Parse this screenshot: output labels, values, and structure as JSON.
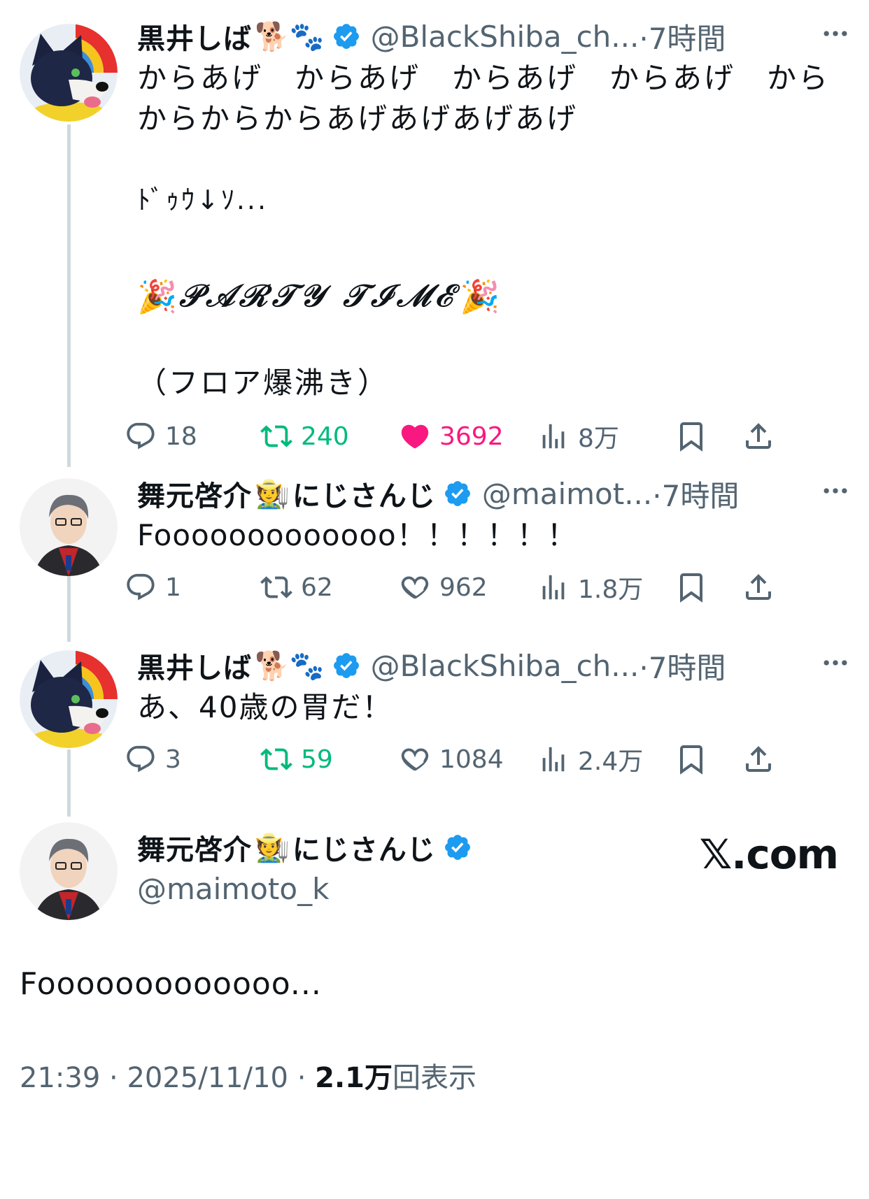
{
  "tweets": [
    {
      "name": "黒井しば",
      "name_emoji": "🐕🐾",
      "handle": "@BlackShiba_ch...",
      "time": "·7時間",
      "text_lines": [
        "からあげ　からあげ　からあげ　からあげ　から",
        "からからからあげあげあげあげ",
        "",
        "ﾄﾞｩｳ↓ｿ...",
        "",
        "PARTY TIME",
        "",
        "（フロア爆沸き）"
      ],
      "party_line": "𝒫𝒜ℛ𝒯𝒴 𝒯ℐℳℰ",
      "party_emoji": "🎉",
      "replies": "18",
      "retweets": "240",
      "likes": "3692",
      "views": "8万",
      "retweeted": true,
      "liked": true
    },
    {
      "name": "舞元啓介",
      "name_emoji": "🧑‍🌾",
      "name_suffix": "にじさんじ",
      "handle": "@maimot...",
      "time": "·7時間",
      "text": "Fooooooooooooo！！！！！！",
      "replies": "1",
      "retweets": "62",
      "likes": "962",
      "views": "1.8万",
      "retweeted": false,
      "liked": false
    },
    {
      "name": "黒井しば",
      "name_emoji": "🐕🐾",
      "handle": "@BlackShiba_ch...",
      "time": "·7時間",
      "text": "あ、40歳の胃だ！",
      "replies": "3",
      "retweets": "59",
      "likes": "1084",
      "views": "2.4万",
      "retweeted": true,
      "liked": false
    }
  ],
  "main": {
    "name": "舞元啓介",
    "name_emoji": "🧑‍🌾",
    "name_suffix": "にじさんじ",
    "handle": "@maimoto_k",
    "brand": "𝕏.com",
    "text": "Fooooooooooooo...",
    "time": "21:39",
    "date": "2025/11/10",
    "views_count": "2.1万",
    "views_label": "回表示",
    "sep": " · "
  },
  "colors": {
    "verified": "#1d9bf0",
    "retweet": "#00ba7c",
    "like": "#f91880",
    "muted": "#536471",
    "thread": "#cfd9de"
  }
}
